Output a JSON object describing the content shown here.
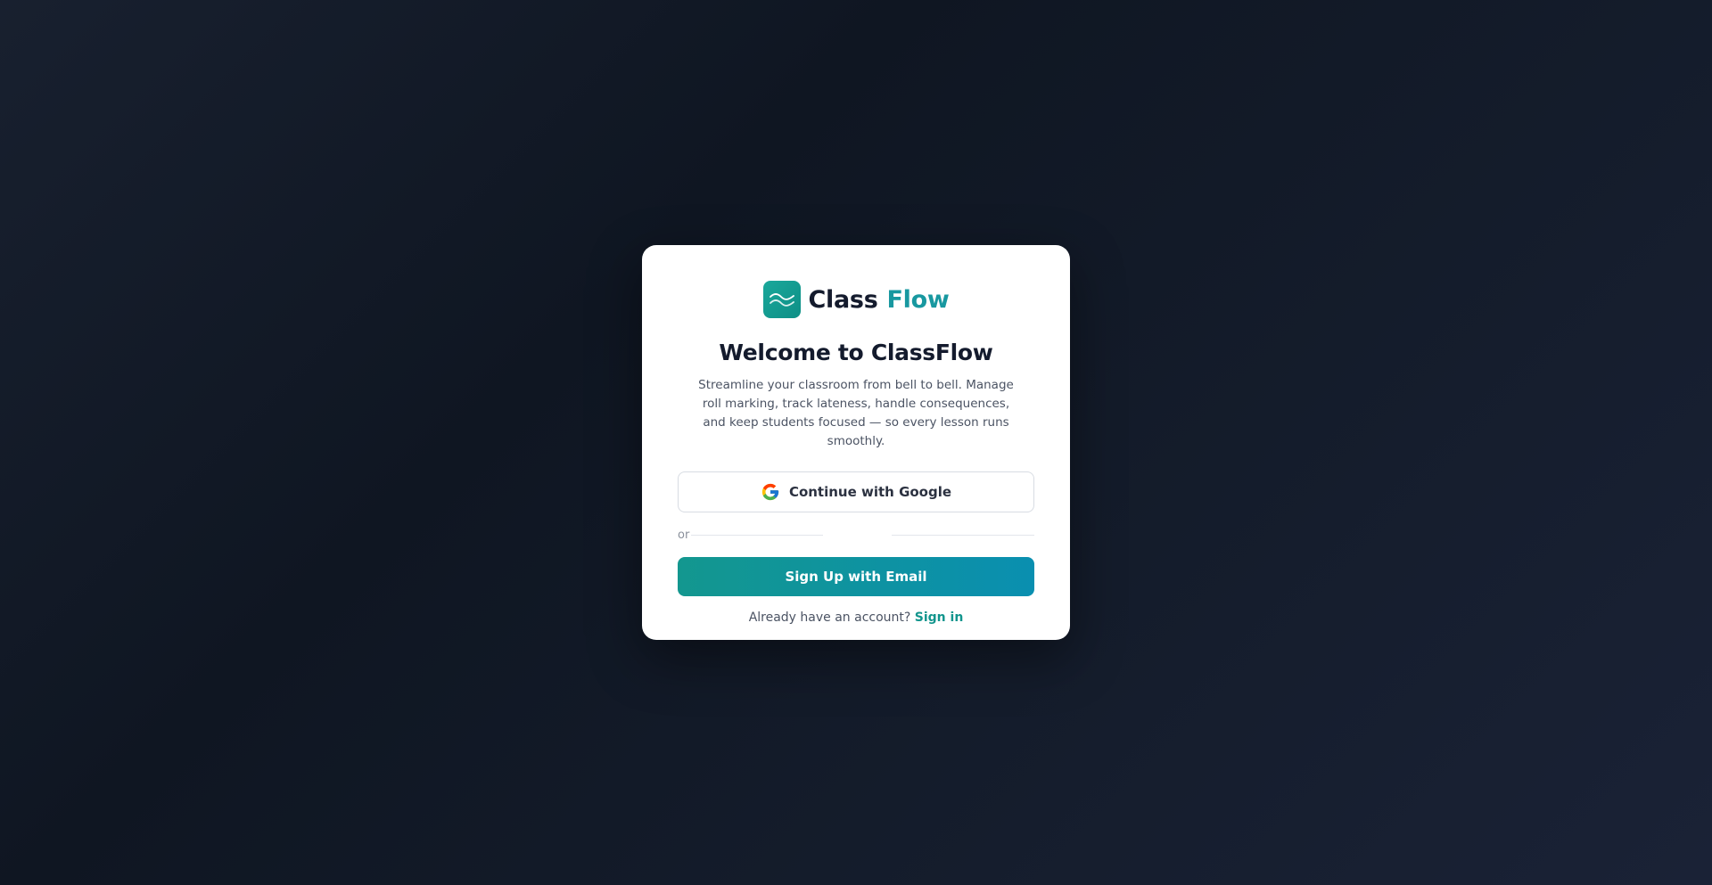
{
  "brand": {
    "name_primary": "Class",
    "name_accent": "Flow",
    "logo_icon": "wave-icon",
    "accent_color": "#1898a0"
  },
  "welcome": {
    "title": "Welcome to ClassFlow",
    "subtitle": "Streamline your classroom from bell to bell. Manage roll marking, track lateness, handle consequences, and keep students focused — so every lesson runs smoothly."
  },
  "auth": {
    "google_label": "Continue with Google",
    "google_icon": "google-icon",
    "divider_text": "or",
    "email_label": "Sign Up with Email",
    "email_button_color": "#13978f",
    "signin_prompt": "Already have an account?",
    "signin_link": "Sign in"
  }
}
